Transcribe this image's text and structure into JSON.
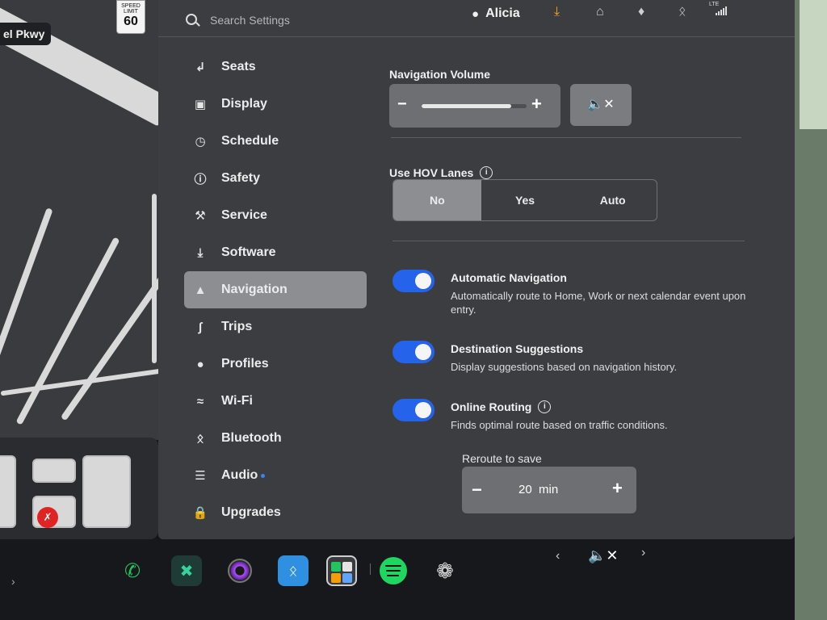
{
  "map": {
    "street": "el Pkwy",
    "speed_limit_label": "SPEED LIMIT",
    "speed_limit": "60"
  },
  "search": {
    "placeholder": "Search Settings"
  },
  "header": {
    "user": "Alicia",
    "icons": [
      "user-icon",
      "download-icon",
      "home-icon",
      "bell-icon",
      "bluetooth-icon",
      "lte-signal-icon"
    ],
    "network": "LTE",
    "accent": "#f5a623"
  },
  "sidebar": {
    "active": "Navigation",
    "items": [
      {
        "label": "Seats",
        "icon": "seat-icon"
      },
      {
        "label": "Display",
        "icon": "display-icon"
      },
      {
        "label": "Schedule",
        "icon": "schedule-icon"
      },
      {
        "label": "Safety",
        "icon": "safety-icon"
      },
      {
        "label": "Service",
        "icon": "wrench-icon"
      },
      {
        "label": "Software",
        "icon": "download-icon"
      },
      {
        "label": "Navigation",
        "icon": "navigation-icon"
      },
      {
        "label": "Trips",
        "icon": "trips-icon"
      },
      {
        "label": "Profiles",
        "icon": "profile-icon"
      },
      {
        "label": "Wi-Fi",
        "icon": "wifi-icon"
      },
      {
        "label": "Bluetooth",
        "icon": "bluetooth-icon"
      },
      {
        "label": "Audio",
        "icon": "audio-sliders-icon"
      },
      {
        "label": "Upgrades",
        "icon": "shopping-bag-icon"
      }
    ]
  },
  "navigation": {
    "volume_title": "Navigation Volume",
    "volume_level": 0.85,
    "hov_title": "Use HOV Lanes",
    "hov_options": [
      "No",
      "Yes",
      "Auto"
    ],
    "hov_selected": "No",
    "toggles": [
      {
        "title": "Automatic Navigation",
        "desc": "Automatically route to Home, Work or next calendar event upon entry.",
        "on": true,
        "info": false
      },
      {
        "title": "Destination Suggestions",
        "desc": "Display suggestions based on navigation history.",
        "on": true,
        "info": false
      },
      {
        "title": "Online Routing",
        "desc": "Finds optimal route based on traffic conditions.",
        "on": true,
        "info": true
      }
    ],
    "reroute_label": "Reroute to save",
    "reroute_value": "20  min",
    "toggle_color": "#2563eb"
  },
  "dock": {
    "apps": [
      "phone-icon",
      "app-x-icon",
      "camera-icon",
      "bluetooth-icon",
      "app-grid-icon",
      "spotify-icon",
      "fan-icon"
    ],
    "media_controls": [
      "prev-icon",
      "mute-icon",
      "next-icon"
    ]
  }
}
